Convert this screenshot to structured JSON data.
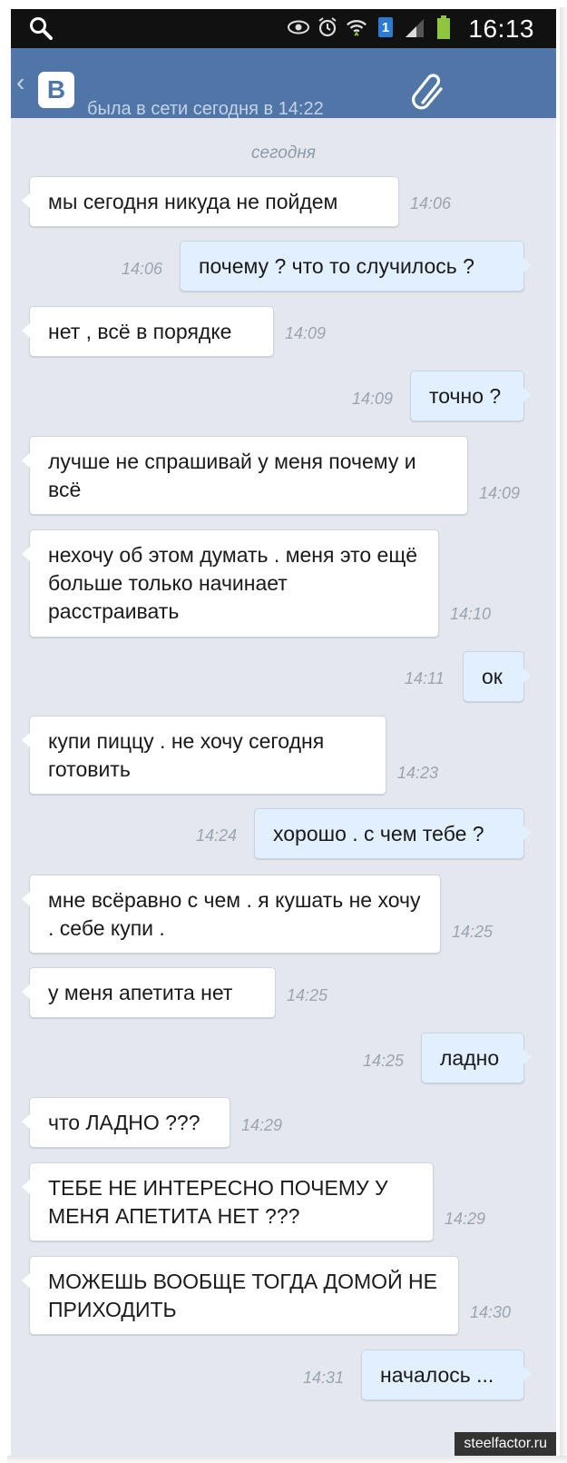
{
  "status_bar": {
    "time": "16:13",
    "sim_label": "1"
  },
  "header": {
    "back_glyph": "‹",
    "logo_text": "В",
    "status": "была в сети сегодня в 14:22"
  },
  "chat": {
    "date_separator": "сегодня",
    "messages": [
      {
        "dir": "in",
        "text": "мы сегодня никуда не пойдем",
        "time": "14:06"
      },
      {
        "dir": "out",
        "text": "почему ? что то случилось ?",
        "time": "14:06"
      },
      {
        "dir": "in",
        "text": "нет , всё в порядке",
        "time": "14:09"
      },
      {
        "dir": "out",
        "text": "точно ?",
        "time": "14:09"
      },
      {
        "dir": "in",
        "text": "лучше не спрашивай у меня почему и всё",
        "time": "14:09"
      },
      {
        "dir": "in",
        "text": "нехочу об этом думать . меня это ещё больше только начинает расстраивать",
        "time": "14:10"
      },
      {
        "dir": "out",
        "text": "ок",
        "time": "14:11"
      },
      {
        "dir": "in",
        "text": "купи пиццу . не хочу сегодня готовить",
        "time": "14:23"
      },
      {
        "dir": "out",
        "text": "хорошо . с чем тебе ?",
        "time": "14:24"
      },
      {
        "dir": "in",
        "text": "мне всёравно с чем . я кушать не хочу . себе купи .",
        "time": "14:25"
      },
      {
        "dir": "in",
        "text": "у меня апетита нет",
        "time": "14:25"
      },
      {
        "dir": "out",
        "text": "ладно",
        "time": "14:25"
      },
      {
        "dir": "in",
        "text": "что ЛАДНО ???",
        "time": "14:29"
      },
      {
        "dir": "in",
        "text": "ТЕБЕ НЕ ИНТЕРЕСНО ПОЧЕМУ У МЕНЯ АПЕТИТА НЕТ ???",
        "time": "14:29"
      },
      {
        "dir": "in",
        "text": "МОЖЕШЬ ВООБЩЕ ТОГДА ДОМОЙ НЕ ПРИХОДИТЬ",
        "time": "14:30"
      },
      {
        "dir": "out",
        "text": "началось ...",
        "time": "14:31"
      }
    ]
  },
  "watermark": "steelfactor.ru",
  "colors": {
    "header_bg": "#5076a7",
    "chat_bg": "#e4e8ee",
    "incoming_bg": "#ffffff",
    "outgoing_bg": "#e2efff"
  }
}
